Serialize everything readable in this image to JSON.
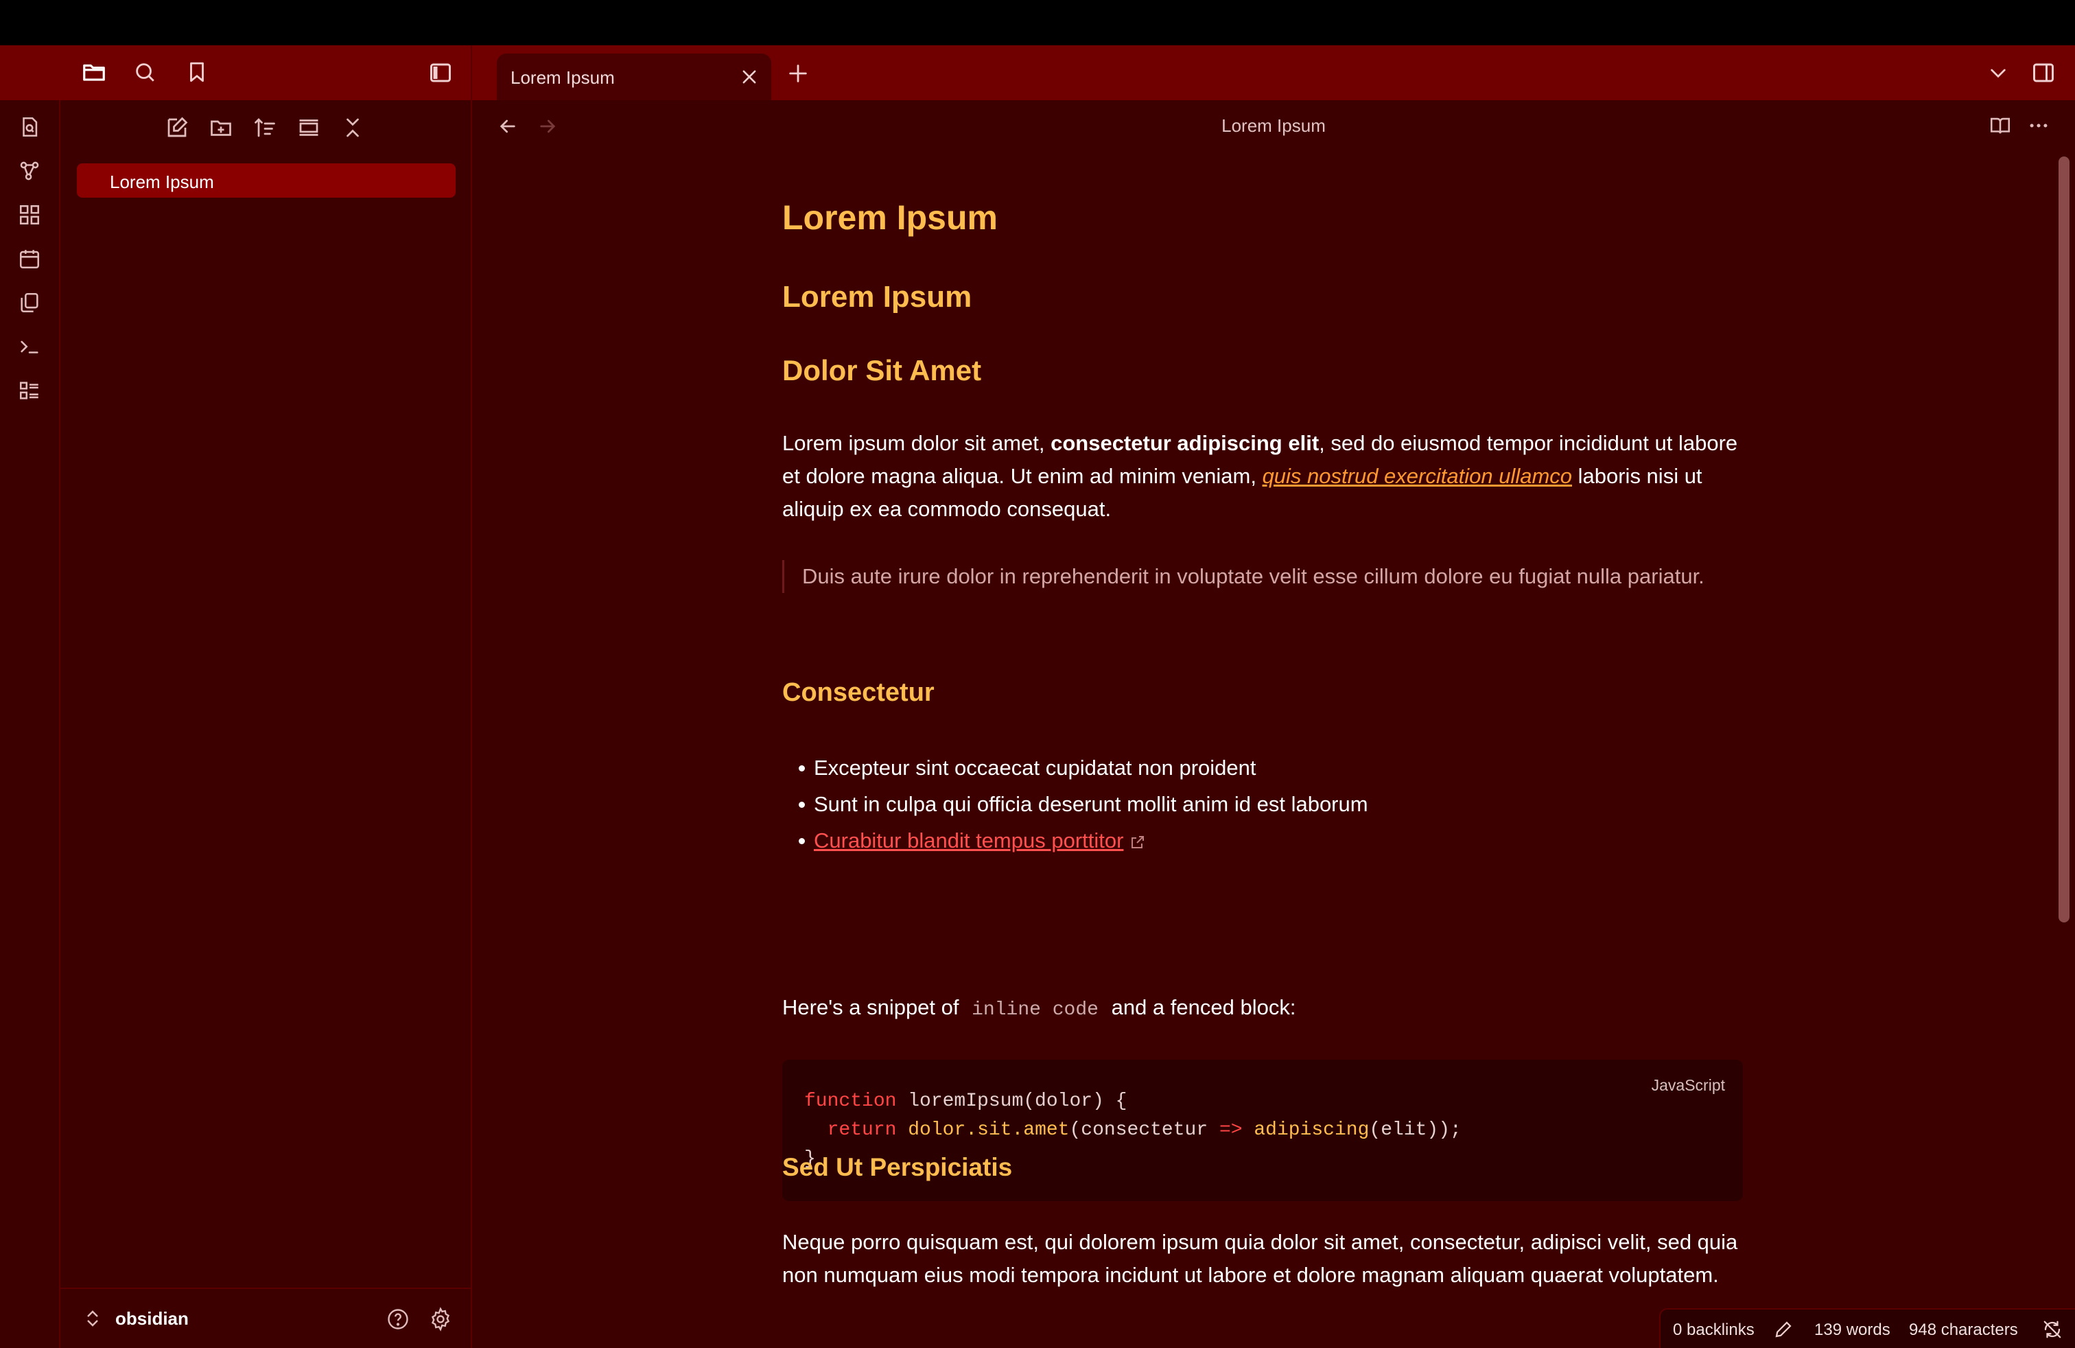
{
  "colors": {
    "accent": "#8a0000",
    "heading": "#ffbd4f",
    "background": "#3c0000",
    "tabbar": "#700000",
    "link": "#ff5050",
    "emphasis_link": "#ff9a33"
  },
  "tabs": [
    {
      "label": "Lorem Ipsum",
      "active": true
    }
  ],
  "sidebar": {
    "toolbar_icons": [
      "new-note-icon",
      "new-folder-icon",
      "sort-icon",
      "collapse-view-icon",
      "collapse-all-icon"
    ],
    "files": [
      {
        "label": "Lorem Ipsum",
        "selected": true
      }
    ],
    "vault_name": "obsidian"
  },
  "ribbon": {
    "icons": [
      "quick-switcher-icon",
      "graph-icon",
      "canvas-icon",
      "daily-note-icon",
      "templates-icon",
      "command-palette-icon",
      "outline-icon"
    ]
  },
  "editor": {
    "view_title": "Lorem Ipsum",
    "h1": "Lorem Ipsum",
    "h2": "Lorem Ipsum",
    "h3": "Dolor Sit Amet",
    "para1": {
      "t1": "Lorem ipsum dolor sit amet, ",
      "bold": "consectetur adipiscing elit",
      "t2": ", sed do eiusmod tempor incididunt ut labore et dolore magna aliqua. Ut enim ad minim veniam, ",
      "em": "quis nostrud exercitation ullamco",
      "t3": " laboris nisi ut aliquip ex ea commodo consequat."
    },
    "quote": "Duis aute irure dolor in reprehenderit in voluptate velit esse cillum dolore eu fugiat nulla pariatur.",
    "h4": "Consectetur",
    "list": [
      "Excepteur sint occaecat cupidatat non proident",
      "Sunt in culpa qui officia deserunt mollit anim id est laborum"
    ],
    "list_link": "Curabitur blandit tempus porttitor",
    "snippet": {
      "before": "Here's a snippet of ",
      "code": "inline code",
      "after": " and a fenced block:"
    },
    "codeblock": {
      "language": "JavaScript",
      "line1_kw": "function",
      "line1_rest": " loremIpsum(dolor) {",
      "line2_kw": "return",
      "line2_fn": "dolor.sit.amet",
      "line2_mid": "(consectetur ",
      "line2_arrow": "=>",
      "line2_fn2": "adipiscing",
      "line2_end": "(elit));",
      "line3": "}"
    },
    "h5": "Sed Ut Perspiciatis",
    "para2": "Neque porro quisquam est, qui dolorem ipsum quia dolor sit amet, consectetur, adipisci velit, sed quia non numquam eius modi tempora incidunt ut labore et dolore magnam aliquam quaerat voluptatem."
  },
  "status": {
    "backlinks": "0 backlinks",
    "words": "139 words",
    "characters": "948 characters"
  }
}
